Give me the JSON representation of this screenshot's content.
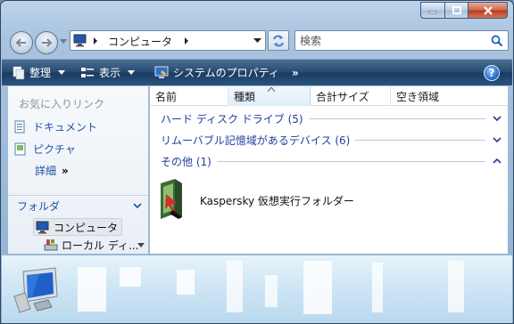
{
  "window": {
    "caption": {
      "minimize": "minimize",
      "maximize": "maximize",
      "close": "close"
    }
  },
  "nav": {
    "address_crumb": "コンピュータ",
    "search_placeholder": "検索"
  },
  "commandbar": {
    "organize": "整理",
    "views": "表示",
    "system_properties": "システムのプロパティ",
    "more": "»",
    "help": "?"
  },
  "navpane": {
    "favorites_title": "お気に入りリンク",
    "documents": "ドキュメント",
    "pictures": "ピクチャ",
    "more": "詳細",
    "more_arrows": "»",
    "folders": "フォルダ",
    "tree_computer": "コンピュータ",
    "tree_local": "ローカル ディ..."
  },
  "content": {
    "columns": [
      "名前",
      "種類",
      "合計サイズ",
      "空き領域"
    ],
    "groups": [
      {
        "label": "ハード ディスク ドライブ (5)",
        "expanded": false
      },
      {
        "label": "リムーバブル記憶域があるデバイス (6)",
        "expanded": false
      },
      {
        "label": "その他 (1)",
        "expanded": true
      }
    ],
    "entry": "Kaspersky 仮想実行フォルダー"
  },
  "colors": {
    "link": "#1f53a8",
    "group": "#1f3e9c",
    "cmdbar": "#27496f"
  }
}
